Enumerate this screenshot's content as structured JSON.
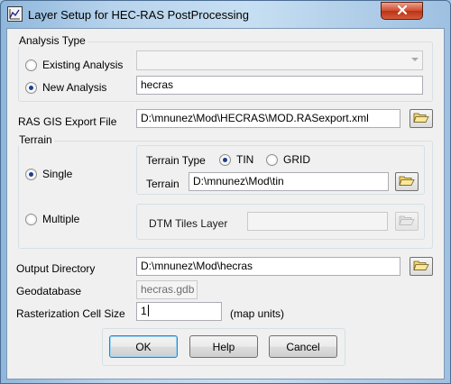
{
  "window": {
    "title": "Layer Setup for HEC-RAS PostProcessing"
  },
  "analysis_type": {
    "group_label": "Analysis Type",
    "existing_label": "Existing Analysis",
    "existing_value": "",
    "existing_selected": false,
    "new_label": "New Analysis",
    "new_value": "hecras",
    "new_selected": true
  },
  "ras_gis_export": {
    "label": "RAS GIS Export File",
    "value": "D:\\mnunez\\Mod\\HECRAS\\MOD.RASexport.xml"
  },
  "terrain": {
    "group_label": "Terrain",
    "single_label": "Single",
    "single_selected": true,
    "terrain_type_label": "Terrain Type",
    "tin_label": "TIN",
    "tin_selected": true,
    "grid_label": "GRID",
    "grid_selected": false,
    "terrain_label": "Terrain",
    "terrain_value": "D:\\mnunez\\Mod\\tin",
    "multiple_label": "Multiple",
    "multiple_selected": false,
    "dtm_tiles_label": "DTM Tiles Layer",
    "dtm_tiles_value": ""
  },
  "output": {
    "label": "Output Directory",
    "value": "D:\\mnunez\\Mod\\hecras"
  },
  "geodatabase": {
    "label": "Geodatabase",
    "value": "hecras.gdb"
  },
  "rasterization": {
    "label": "Rasterization Cell Size",
    "value": "1",
    "units": "(map units)"
  },
  "buttons": {
    "ok": "OK",
    "help": "Help",
    "cancel": "Cancel"
  },
  "icons": {
    "app": "layer-setup-app-icon",
    "close": "close-icon",
    "browse": "open-folder-icon"
  },
  "colors": {
    "title_bar": "#b7d3ec",
    "close_button": "#cf4b2f",
    "dialog_bg": "#f0f0f0",
    "radio_selected": "#1a3f8f"
  }
}
